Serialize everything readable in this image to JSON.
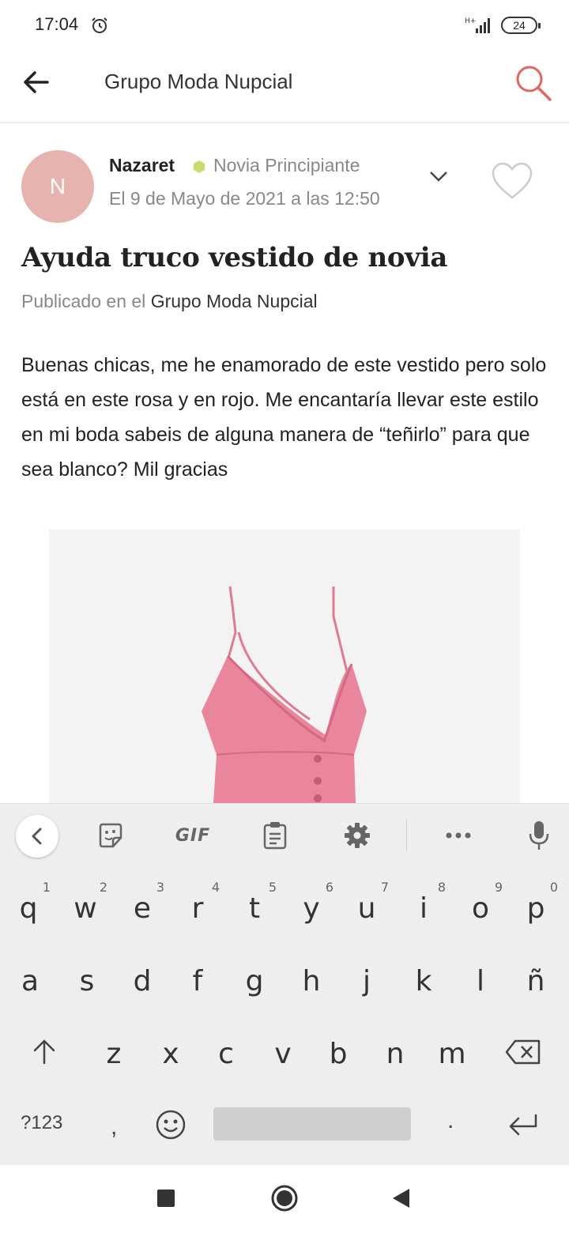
{
  "status_bar": {
    "time": "17:04",
    "network": "H+",
    "battery": "24"
  },
  "app_bar": {
    "title": "Grupo Moda Nupcial"
  },
  "post": {
    "avatar_letter": "N",
    "author": "Nazaret",
    "rank": "Novia Principiante",
    "date": "El 9 de Mayo de 2021 a las 12:50",
    "title": "Ayuda truco vestido de novia",
    "published_prefix": "Publicado en el",
    "published_group": "Grupo Moda Nupcial",
    "body": "Buenas chicas, me he enamorado de este vestido pero solo está en este rosa y en rojo. Me encantaría llevar este estilo en mi boda sabeis de alguna manera de “teñirlo” para que sea blanco? Mil gracias"
  },
  "keyboard": {
    "toolbar": {
      "gif_label": "GIF"
    },
    "row1": [
      {
        "ch": "q",
        "hint": "1"
      },
      {
        "ch": "w",
        "hint": "2"
      },
      {
        "ch": "e",
        "hint": "3"
      },
      {
        "ch": "r",
        "hint": "4"
      },
      {
        "ch": "t",
        "hint": "5"
      },
      {
        "ch": "y",
        "hint": "6"
      },
      {
        "ch": "u",
        "hint": "7"
      },
      {
        "ch": "i",
        "hint": "8"
      },
      {
        "ch": "o",
        "hint": "9"
      },
      {
        "ch": "p",
        "hint": "0"
      }
    ],
    "row2": [
      "a",
      "s",
      "d",
      "f",
      "g",
      "h",
      "j",
      "k",
      "l",
      "ñ"
    ],
    "row3": [
      "z",
      "x",
      "c",
      "v",
      "b",
      "n",
      "m"
    ],
    "numbers_label": "?123",
    "comma": ",",
    "period": "."
  },
  "colors": {
    "accent": "#e0675f",
    "avatar_bg": "#e6b3ae",
    "rank_dot": "#c8dc6e",
    "dress": "#e9869d"
  }
}
